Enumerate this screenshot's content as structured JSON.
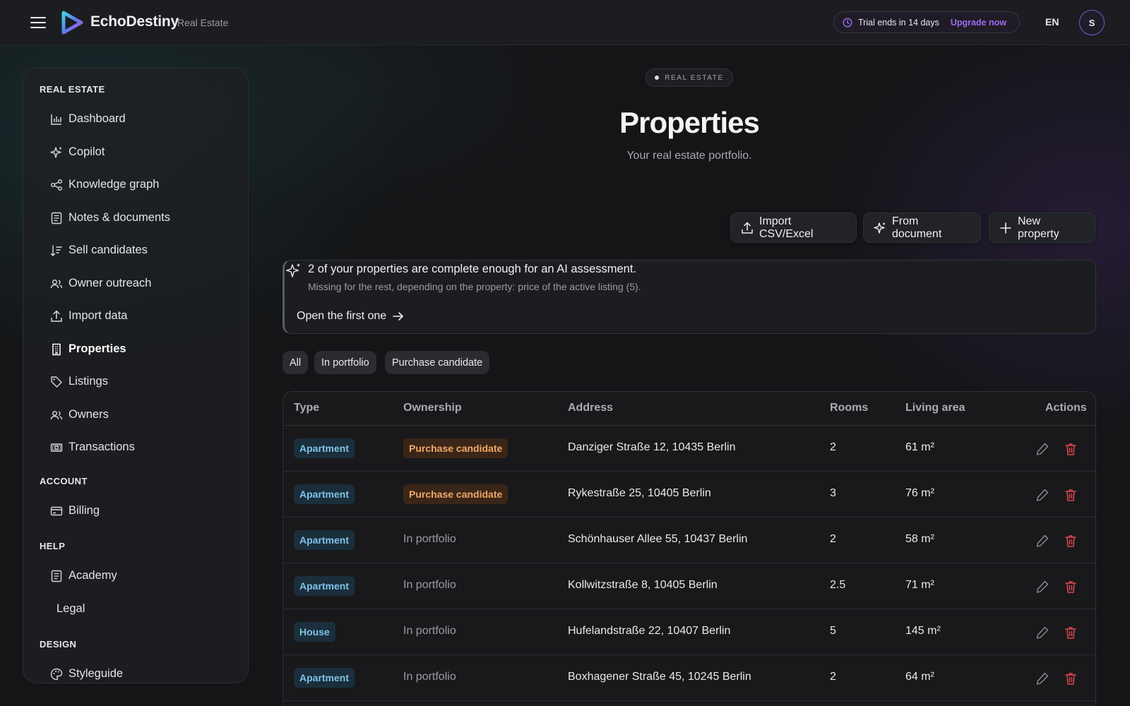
{
  "app": {
    "brand": "EchoDestiny",
    "brand_sub": "Real Estate"
  },
  "topbar": {
    "trial_text": "Trial ends in 14 days",
    "upgrade_label": "Upgrade now",
    "language": "EN",
    "avatar_initial": "S"
  },
  "sidebar": {
    "sections": [
      {
        "title": "REAL ESTATE",
        "items": [
          {
            "label": "Dashboard",
            "icon": "bar-chart-icon"
          },
          {
            "label": "Copilot",
            "icon": "sparkle-icon"
          },
          {
            "label": "Knowledge graph",
            "icon": "share-nodes-icon"
          },
          {
            "label": "Notes & documents",
            "icon": "document-icon"
          },
          {
            "label": "Sell candidates",
            "icon": "sort-descending-icon"
          },
          {
            "label": "Owner outreach",
            "icon": "users-icon"
          },
          {
            "label": "Import data",
            "icon": "upload-icon"
          },
          {
            "label": "Properties",
            "icon": "building-icon",
            "active": true
          },
          {
            "label": "Listings",
            "icon": "tag-icon"
          },
          {
            "label": "Owners",
            "icon": "users-icon"
          },
          {
            "label": "Transactions",
            "icon": "banknote-icon"
          }
        ]
      },
      {
        "title": "ACCOUNT",
        "items": [
          {
            "label": "Billing",
            "icon": "credit-card-icon"
          }
        ]
      },
      {
        "title": "HELP",
        "items": [
          {
            "label": "Academy",
            "icon": "document-icon"
          },
          {
            "label": "Legal",
            "icon": ""
          }
        ]
      },
      {
        "title": "DESIGN",
        "items": [
          {
            "label": "Styleguide",
            "icon": "palette-icon"
          }
        ]
      }
    ]
  },
  "main": {
    "eyebrow": "REAL ESTATE",
    "title": "Properties",
    "subtitle": "Your real estate portfolio.",
    "actions": {
      "import": "Import CSV/Excel",
      "from_document": "From document",
      "new_property": "New property"
    },
    "banner": {
      "title": "2 of your properties are complete enough for an AI assessment.",
      "description": "Missing for the rest, depending on the property: price of the active listing (5).",
      "link": "Open the first one"
    },
    "filters": [
      "All",
      "In portfolio",
      "Purchase candidate"
    ],
    "table": {
      "columns": [
        "Type",
        "Ownership",
        "Address",
        "Rooms",
        "Living area",
        "Actions"
      ],
      "rows": [
        {
          "type": "Apartment",
          "ownership": "Purchase candidate",
          "address": "Danziger Straße 12, 10435 Berlin",
          "rooms": "2",
          "area": "61 m²"
        },
        {
          "type": "Apartment",
          "ownership": "Purchase candidate",
          "address": "Rykestraße 25, 10405 Berlin",
          "rooms": "3",
          "area": "76 m²"
        },
        {
          "type": "Apartment",
          "ownership": "In portfolio",
          "address": "Schönhauser Allee 55, 10437 Berlin",
          "rooms": "2",
          "area": "58 m²"
        },
        {
          "type": "Apartment",
          "ownership": "In portfolio",
          "address": "Kollwitzstraße 8, 10405 Berlin",
          "rooms": "2.5",
          "area": "71 m²"
        },
        {
          "type": "House",
          "ownership": "In portfolio",
          "address": "Hufelandstraße 22, 10407 Berlin",
          "rooms": "5",
          "area": "145 m²"
        },
        {
          "type": "Apartment",
          "ownership": "In portfolio",
          "address": "Boxhagener Straße 45, 10245 Berlin",
          "rooms": "2",
          "area": "64 m²"
        }
      ]
    }
  },
  "colors": {
    "accent": "#9d6cf0",
    "tag_type_text": "#7ec3e8",
    "tag_candidate_text": "#f2a766",
    "delete": "#e0484f"
  }
}
